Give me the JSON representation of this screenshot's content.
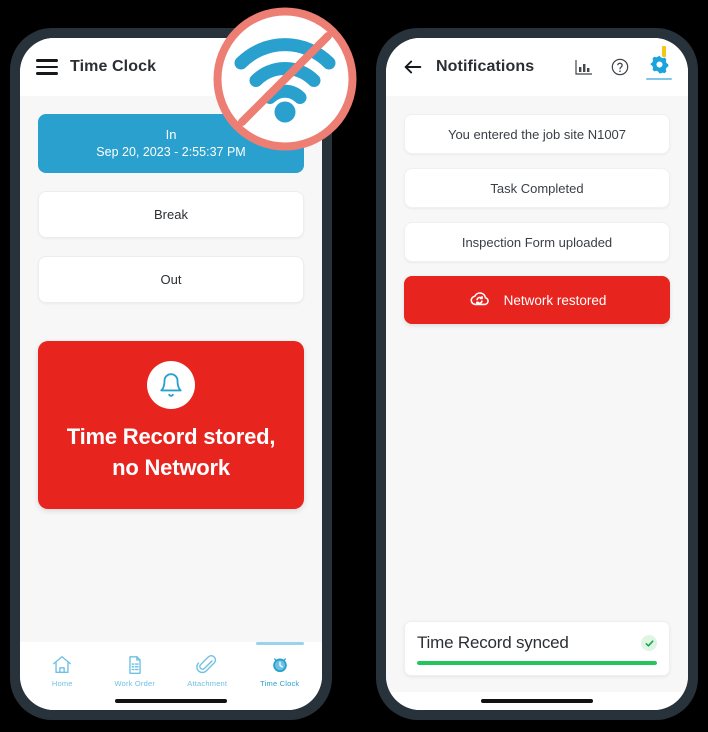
{
  "colors": {
    "frame": "#28323B",
    "screen_bg": "#F7F7F7",
    "accent_blue": "#2AA0CE",
    "nav_blue": "#6EC1E4",
    "danger_red": "#E8241E",
    "success_green": "#22C55E",
    "badge_ring": "#EC7E73",
    "badge_wifi": "#2AA0CE",
    "notification_dot": "#F5C518"
  },
  "overlay": {
    "badge_icon": "no-wifi-icon",
    "badge_label": "No Network"
  },
  "left_phone": {
    "appbar": {
      "menu_icon": "hamburger-menu-icon",
      "title": "Time Clock",
      "chart_icon": "bar-chart-icon"
    },
    "clock_buttons": [
      {
        "id": "in",
        "label": "In",
        "sublabel": "Sep 20, 2023 - 2:55:37 PM",
        "state": "active"
      },
      {
        "id": "break",
        "label": "Break",
        "sublabel": "",
        "state": "default"
      },
      {
        "id": "out",
        "label": "Out",
        "sublabel": "",
        "state": "default"
      }
    ],
    "alert": {
      "icon": "bell-icon",
      "line1": "Time Record stored,",
      "line2": "no Network"
    },
    "bottom_nav": [
      {
        "label": "Home",
        "icon": "home-icon",
        "active": false
      },
      {
        "label": "Work Order",
        "icon": "document-list-icon",
        "active": false
      },
      {
        "label": "Attachment",
        "icon": "paperclip-icon",
        "active": false
      },
      {
        "label": "Time Clock",
        "icon": "clock-icon",
        "active": true
      }
    ]
  },
  "right_phone": {
    "appbar": {
      "back_icon": "back-arrow-icon",
      "title": "Notifications",
      "chart_icon": "bar-chart-icon",
      "help_icon": "help-circle-icon",
      "settings_icon": "gear-icon"
    },
    "notifications": [
      {
        "text": "You entered the job site N1007",
        "type": "default",
        "icon": ""
      },
      {
        "text": "Task Completed",
        "type": "default",
        "icon": ""
      },
      {
        "text": "Inspection Form uploaded",
        "type": "default",
        "icon": ""
      },
      {
        "text": "Network restored",
        "type": "danger",
        "icon": "cloud-sync-icon"
      }
    ],
    "sync_status": {
      "text": "Time Record synced",
      "status_icon": "check-circle-icon",
      "progress_percent": 100
    }
  }
}
